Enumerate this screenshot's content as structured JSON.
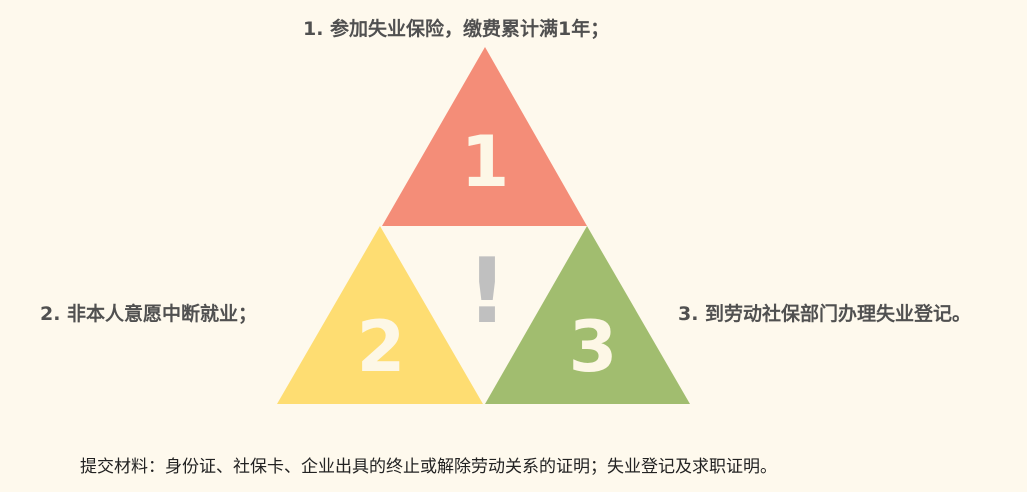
{
  "conditions": {
    "c1": "1. 参加失业保险，缴费累计满1年；",
    "c2": "2. 非本人意愿中断就业；",
    "c3": "3. 到劳动社保部门办理失业登记。"
  },
  "triangles": {
    "t1": {
      "number": "1",
      "color": "#f48d78"
    },
    "t2": {
      "number": "2",
      "color": "#fedd72"
    },
    "t3": {
      "number": "3",
      "color": "#a1bd6f"
    },
    "number_color": "#fdf7e6"
  },
  "center": {
    "mark": "!",
    "color": "#c0c0c0"
  },
  "footer": "提交材料：身份证、社保卡、企业出具的终止或解除劳动关系的证明；失业登记及求职证明。",
  "background": "#fef9ed"
}
